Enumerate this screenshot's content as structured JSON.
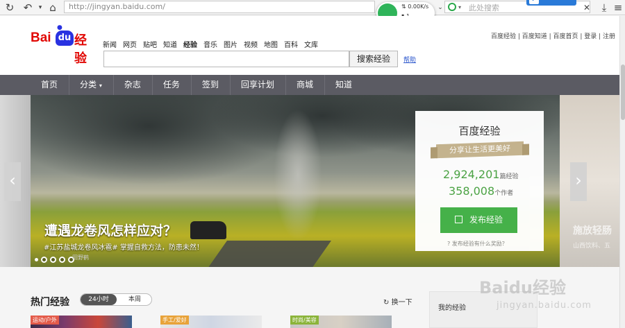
{
  "browser": {
    "address": "http://jingyan.baidu.com/",
    "search_placeholder": "此处搜索",
    "back_icon": "back-arrow-icon",
    "refresh_icon": "refresh-icon",
    "home_icon": "home-icon",
    "wifi": {
      "speed": "0.00K/s",
      "count": "1"
    },
    "download_icon": "download-icon",
    "menu_icon": "hamburger-menu-icon"
  },
  "top_links": "百度经验 | 百度知道 | 百度首页 | 登录 | 注册",
  "logo": {
    "bai": "Bai",
    "du": "du",
    "jingyan": "经验"
  },
  "nav_items": [
    "新闻",
    "网页",
    "贴吧",
    "知道",
    "经验",
    "音乐",
    "图片",
    "视频",
    "地图",
    "百科",
    "文库"
  ],
  "search": {
    "button": "搜索经验",
    "help": "帮助"
  },
  "menu": [
    "首页",
    "分类",
    "杂志",
    "任务",
    "签到",
    "回享计划",
    "商城",
    "知道"
  ],
  "banner": {
    "title": "遭遇龙卷风怎样应对？",
    "subtitle": "#江苏盐城龙卷风冰雹# 掌握自救方法，防患未然！",
    "credit": "田野鹤"
  },
  "card": {
    "title": "百度经验",
    "slogan": "分享让生活更美好",
    "experiences": "2,924,201",
    "experiences_unit": "篇经验",
    "authors": "358,008",
    "authors_unit": "个作者",
    "publish": "发布经验",
    "reward": "发布经验有什么奖励？"
  },
  "right_peek": {
    "title": "施放轻肠",
    "sub": "山西饮料、五"
  },
  "hot": {
    "title": "热门经验",
    "tab_24h": "24小时",
    "tab_week": "本周",
    "refresh": "换一下",
    "tags": [
      "运动/户外",
      "手工/爱好",
      "时尚/美容"
    ],
    "mine": "我的经验"
  },
  "watermark": {
    "main": "Baidu经验",
    "url": "jingyan.baidu.com"
  }
}
